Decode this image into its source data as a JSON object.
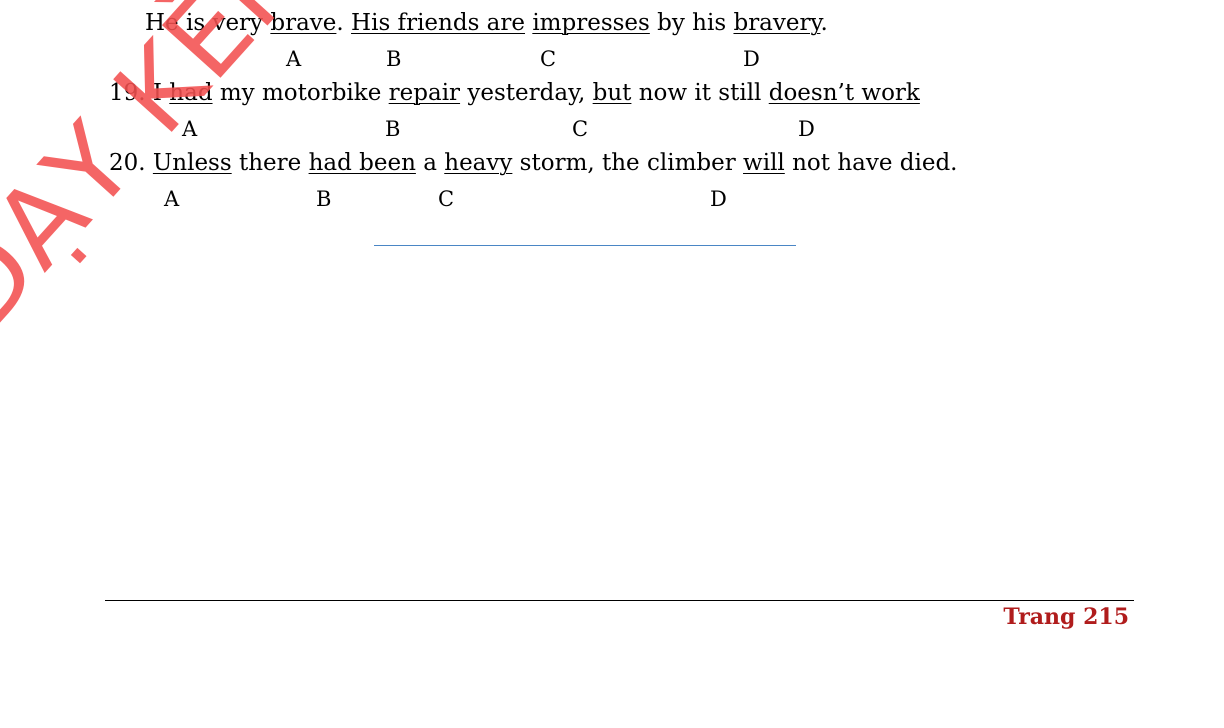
{
  "questions": [
    {
      "prefix": "",
      "segments": [
        {
          "text": "He is very ",
          "u": false
        },
        {
          "text": "brave",
          "u": true
        },
        {
          "text": ". ",
          "u": false
        },
        {
          "text": "His friends are",
          "u": true
        },
        {
          "text": " ",
          "u": false
        },
        {
          "text": "impresses",
          "u": true
        },
        {
          "text": " by his ",
          "u": false
        },
        {
          "text": "bravery",
          "u": true
        },
        {
          "text": ".",
          "u": false
        }
      ],
      "options": [
        "A",
        "B",
        "C",
        "D"
      ]
    },
    {
      "prefix": "19. ",
      "segments": [
        {
          "text": "I ",
          "u": false
        },
        {
          "text": "had",
          "u": true
        },
        {
          "text": " my motorbike ",
          "u": false
        },
        {
          "text": "repair",
          "u": true
        },
        {
          "text": " yesterday, ",
          "u": false
        },
        {
          "text": "but",
          "u": true
        },
        {
          "text": " now it still ",
          "u": false
        },
        {
          "text": "doesn’t work",
          "u": true
        }
      ],
      "options": [
        "A",
        "B",
        "C",
        "D"
      ]
    },
    {
      "prefix": "20. ",
      "segments": [
        {
          "text": "Unless",
          "u": true
        },
        {
          "text": " there ",
          "u": false
        },
        {
          "text": "had been",
          "u": true
        },
        {
          "text": " a ",
          "u": false
        },
        {
          "text": "heavy",
          "u": true
        },
        {
          "text": " storm, the climber ",
          "u": false
        },
        {
          "text": "will",
          "u": true
        },
        {
          "text": " not have died.",
          "u": false
        }
      ],
      "options": [
        "A",
        "B",
        "C",
        "D"
      ]
    }
  ],
  "footer": {
    "page_label": "Trang 215"
  },
  "watermark": {
    "text": "DẠY KÈM QUY"
  }
}
